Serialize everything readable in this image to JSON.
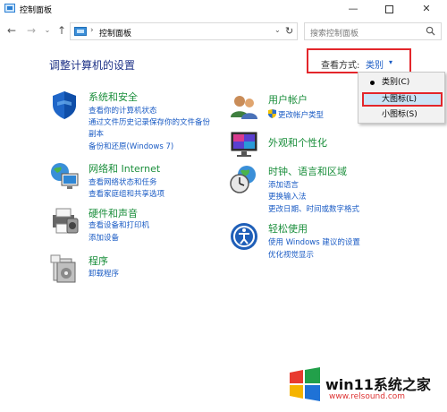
{
  "window": {
    "title": "控制面板",
    "minimize_glyph": "—",
    "close_glyph": "✕"
  },
  "navigation": {
    "back_glyph": "←",
    "forward_glyph": "→",
    "history_glyph": "⌄",
    "up_glyph": "↑",
    "address_separator": "›",
    "address_text": "控制面板",
    "address_dropdown_glyph": "⌄",
    "refresh_glyph": "↻",
    "search_placeholder": "搜索控制面板"
  },
  "main": {
    "heading": "调整计算机的设置",
    "view_by": {
      "label": "查看方式:",
      "value": "类别",
      "arrow": "▾",
      "options": [
        "类别(C)",
        "大图标(L)",
        "小图标(S)"
      ],
      "selected": "类别(C)",
      "highlighted": "大图标(L)"
    }
  },
  "categories": {
    "system": {
      "title": "系统和安全",
      "links": [
        "查看你的计算机状态",
        "通过文件历史记录保存你的文件备份",
        "副本",
        "备份和还原(Windows 7)"
      ]
    },
    "network": {
      "title": "网络和 Internet",
      "links": [
        "查看网络状态和任务",
        "查看家庭组和共享选项"
      ]
    },
    "hardware": {
      "title": "硬件和声音",
      "links": [
        "查看设备和打印机",
        "添加设备"
      ]
    },
    "programs": {
      "title": "程序",
      "links": [
        "卸载程序"
      ]
    },
    "users": {
      "title": "用户帐户",
      "links": [
        "更改帐户类型"
      ]
    },
    "appearance": {
      "title": "外观和个性化"
    },
    "clock": {
      "title": "时钟、语言和区域",
      "links": [
        "添加语言",
        "更换输入法",
        "更改日期、时间或数字格式"
      ]
    },
    "ease": {
      "title": "轻松使用",
      "links": [
        "使用 Windows 建议的设置",
        "优化视觉显示"
      ]
    }
  },
  "watermark": {
    "title": "win11系统之家",
    "url": "www.relsound.com"
  },
  "colors": {
    "title_green": "#1a8e3b",
    "link_blue": "#1a5bc4",
    "heading_blue": "#1e3287",
    "highlight_red": "#e3262b",
    "menu_selected_bg": "#cce4f7"
  }
}
